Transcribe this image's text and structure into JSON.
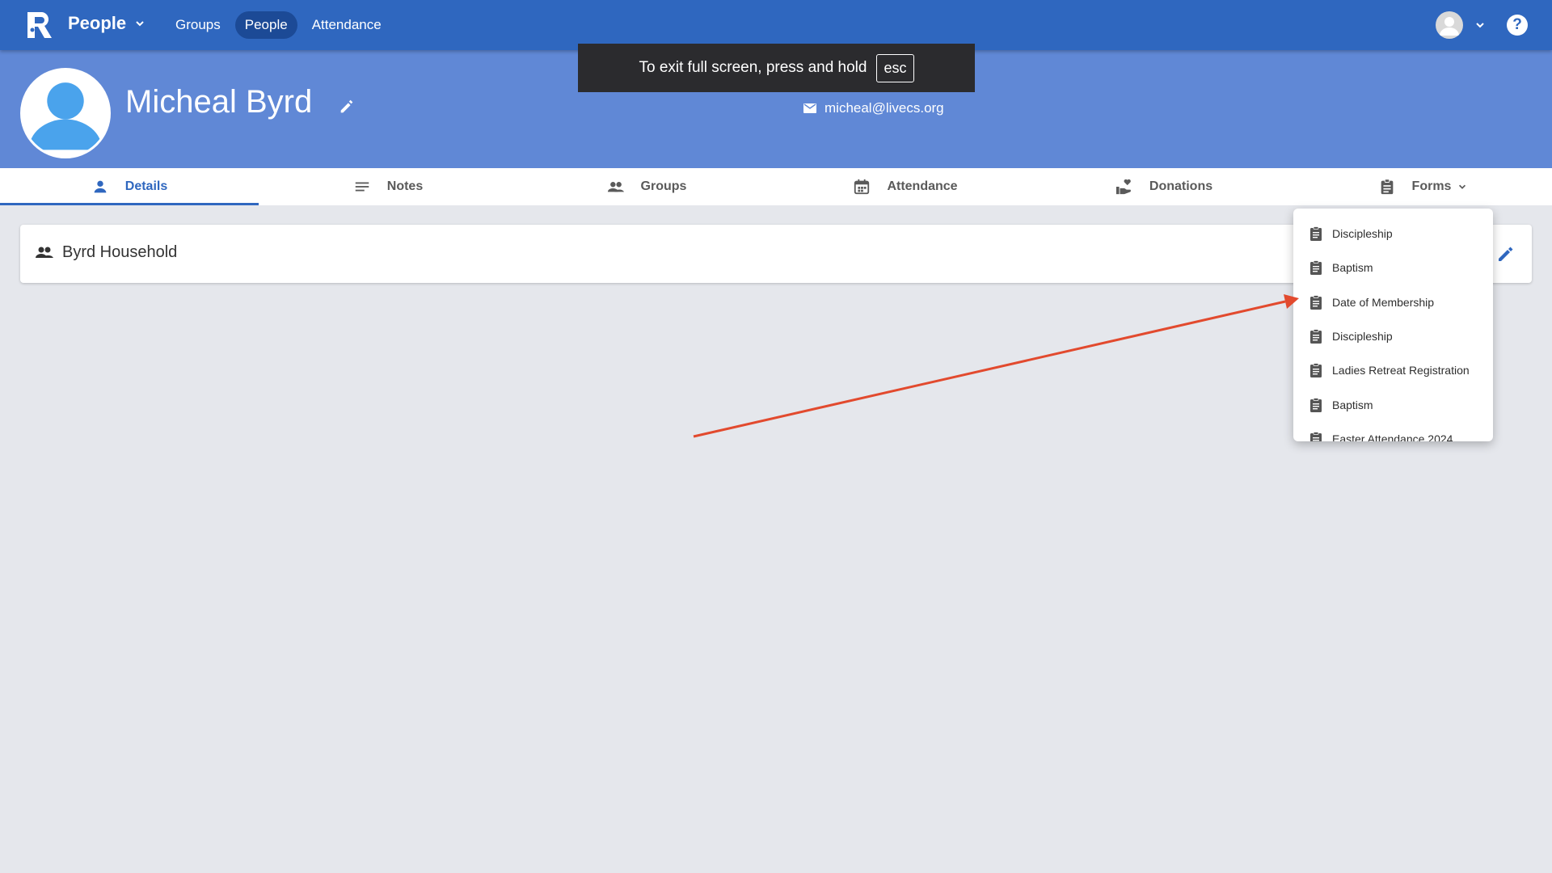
{
  "appbar": {
    "title": "People",
    "nav": [
      "Groups",
      "People",
      "Attendance"
    ],
    "active_nav": "People",
    "brand_color": "#2f67bf"
  },
  "fullscreen_toast": {
    "text": "To exit full screen, press and hold",
    "key": "esc"
  },
  "profile": {
    "name": "Micheal Byrd",
    "email": "micheal@livecs.org",
    "header_color": "#6088d6"
  },
  "tabs": [
    {
      "label": "Details",
      "icon": "person-icon",
      "active": true
    },
    {
      "label": "Notes",
      "icon": "notes-icon",
      "active": false
    },
    {
      "label": "Groups",
      "icon": "groups-icon",
      "active": false
    },
    {
      "label": "Attendance",
      "icon": "calendar-icon",
      "active": false
    },
    {
      "label": "Donations",
      "icon": "donation-icon",
      "active": false
    },
    {
      "label": "Forms",
      "icon": "clipboard-icon",
      "active": false
    }
  ],
  "household": {
    "title": "Byrd Household"
  },
  "forms_menu": {
    "items": [
      "Discipleship",
      "Baptism",
      "Date of Membership",
      "Discipleship",
      "Ladies Retreat Registration",
      "Baptism",
      "Easter Attendance 2024"
    ]
  },
  "annotation": {
    "arrow_color": "#e24a2e"
  }
}
